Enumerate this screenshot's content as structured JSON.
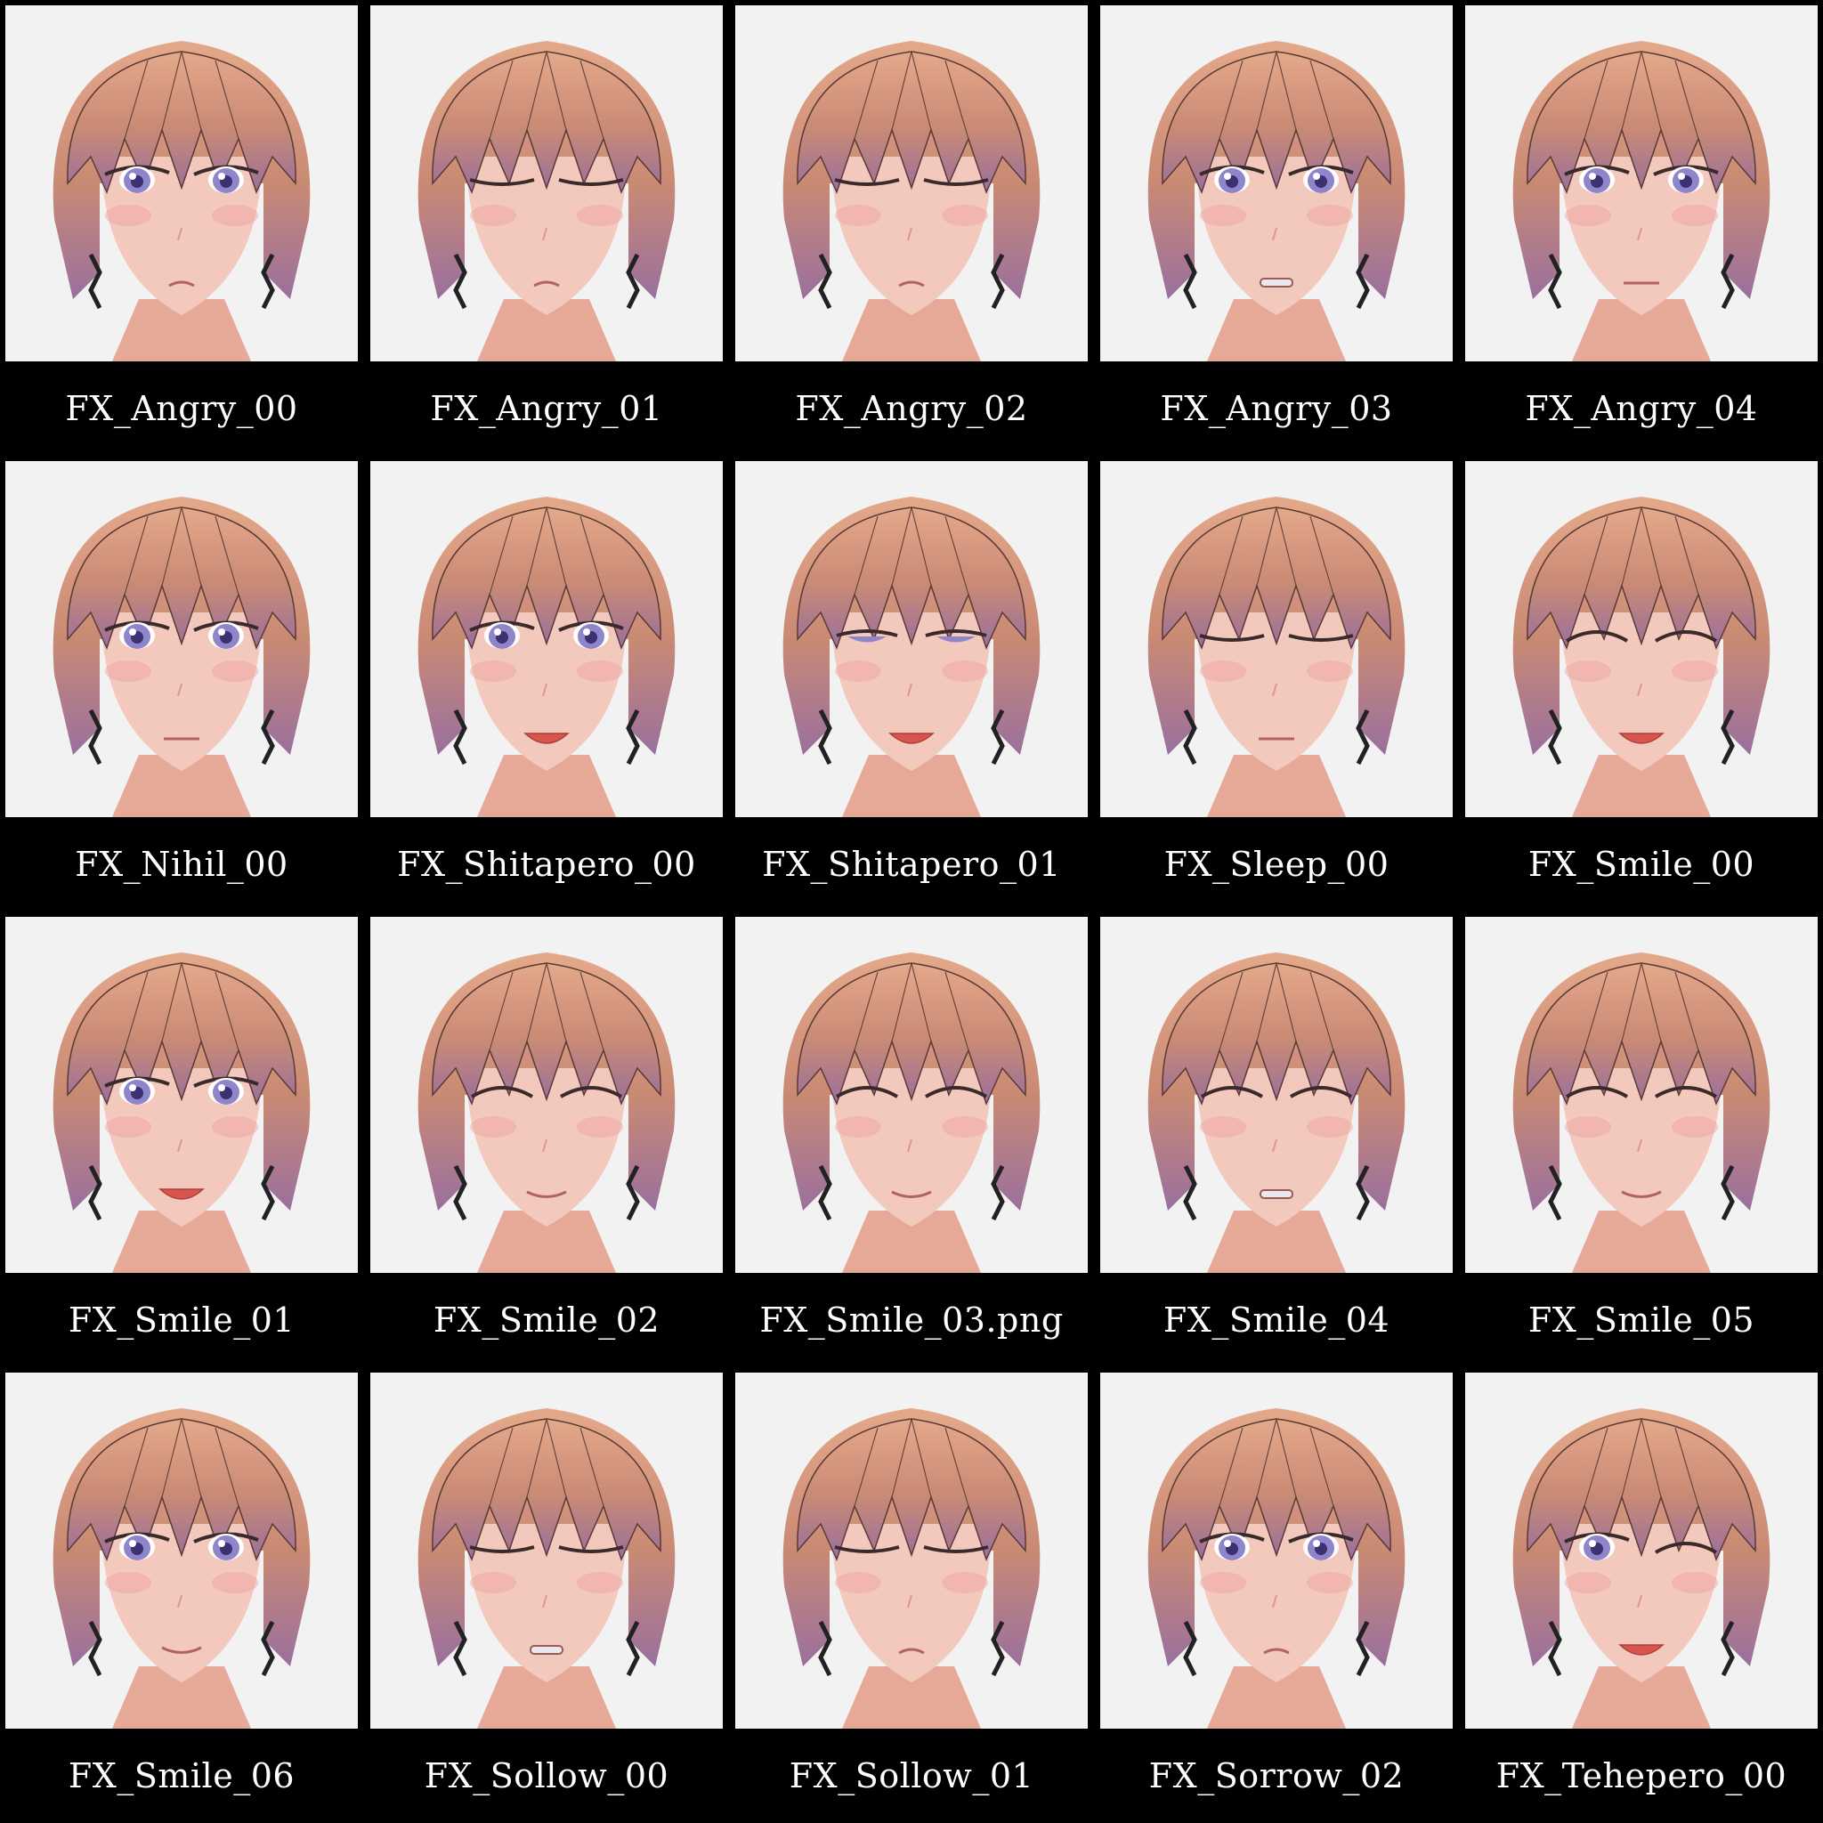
{
  "colors": {
    "background": "#000000",
    "tile": "#f2f2f2",
    "label_text": "#ffffff",
    "hair": "#c98a74",
    "skin": "#f3c9bd",
    "iris": "#8f86c9",
    "lips": "#d9544d"
  },
  "tiles": [
    {
      "label": "FX_Angry_00",
      "eyes": "open",
      "mouth": "frown"
    },
    {
      "label": "FX_Angry_01",
      "eyes": "closed",
      "mouth": "frown"
    },
    {
      "label": "FX_Angry_02",
      "eyes": "closed",
      "mouth": "frown"
    },
    {
      "label": "FX_Angry_03",
      "eyes": "open",
      "mouth": "teeth"
    },
    {
      "label": "FX_Angry_04",
      "eyes": "open",
      "mouth": "line"
    },
    {
      "label": "FX_Nihil_00",
      "eyes": "open",
      "mouth": "line"
    },
    {
      "label": "FX_Shitapero_00",
      "eyes": "open",
      "mouth": "tongue"
    },
    {
      "label": "FX_Shitapero_01",
      "eyes": "half",
      "mouth": "tongue"
    },
    {
      "label": "FX_Sleep_00",
      "eyes": "closed",
      "mouth": "line"
    },
    {
      "label": "FX_Smile_00",
      "eyes": "happy",
      "mouth": "tongue"
    },
    {
      "label": "FX_Smile_01",
      "eyes": "open",
      "mouth": "tongue"
    },
    {
      "label": "FX_Smile_02",
      "eyes": "happy",
      "mouth": "smile"
    },
    {
      "label": "FX_Smile_03.png",
      "eyes": "happy",
      "mouth": "smile"
    },
    {
      "label": "FX_Smile_04",
      "eyes": "happy",
      "mouth": "teeth"
    },
    {
      "label": "FX_Smile_05",
      "eyes": "happy",
      "mouth": "smile"
    },
    {
      "label": "FX_Smile_06",
      "eyes": "open",
      "mouth": "smile"
    },
    {
      "label": "FX_Sollow_00",
      "eyes": "closed",
      "mouth": "teeth"
    },
    {
      "label": "FX_Sollow_01",
      "eyes": "closed",
      "mouth": "frown"
    },
    {
      "label": "FX_Sorrow_02",
      "eyes": "open",
      "mouth": "frown"
    },
    {
      "label": "FX_Tehepero_00",
      "eyes": "wink",
      "mouth": "tongue"
    }
  ]
}
